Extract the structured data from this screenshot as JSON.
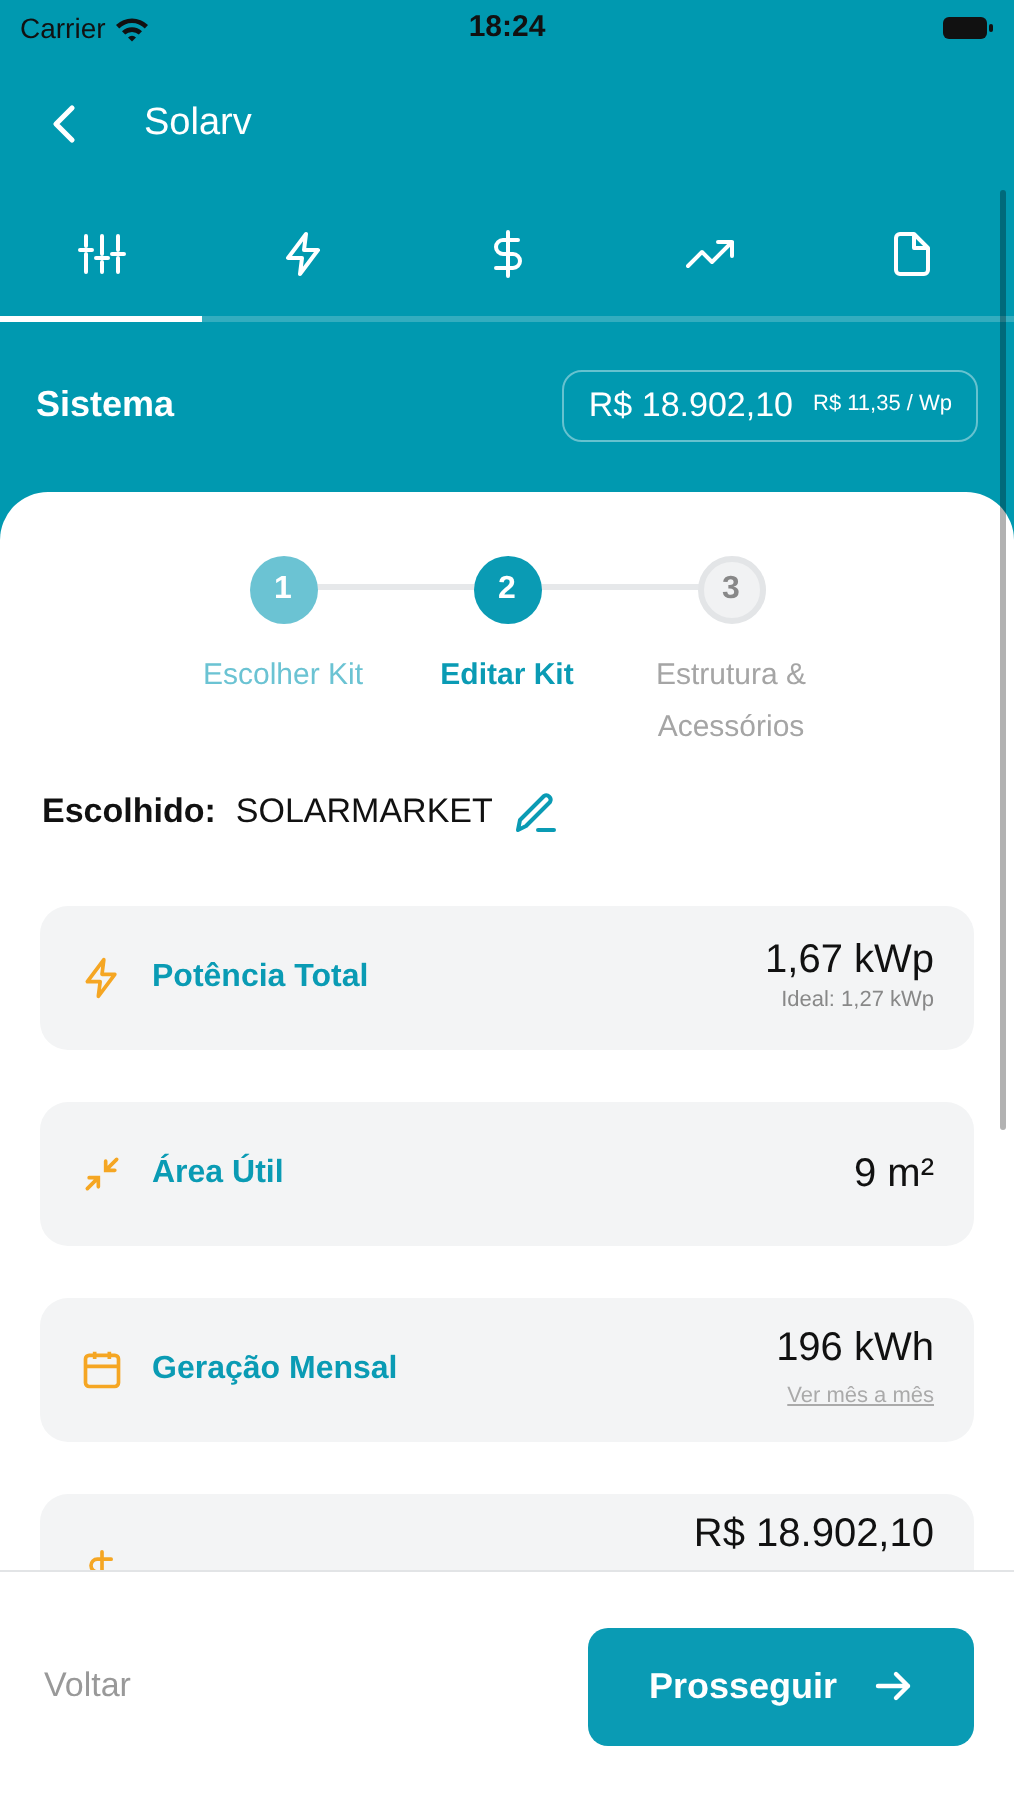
{
  "status_bar": {
    "carrier": "Carrier",
    "time": "18:24"
  },
  "header": {
    "title": "Solarv"
  },
  "tabs": [
    {
      "kind": "sliders",
      "selected": true
    },
    {
      "kind": "bolt",
      "selected": false
    },
    {
      "kind": "dollar",
      "selected": false
    },
    {
      "kind": "trend",
      "selected": false
    },
    {
      "kind": "file",
      "selected": false
    }
  ],
  "summary": {
    "label": "Sistema",
    "price": "R$ 18.902,10",
    "unit_price": "R$ 11,35 / Wp"
  },
  "steps": [
    {
      "number": "1",
      "label": "Escolher Kit",
      "completed": true,
      "selected": false
    },
    {
      "number": "2",
      "label": "Editar Kit",
      "completed": false,
      "selected": true
    },
    {
      "number": "3",
      "label": "Estrutura & Acessórios",
      "completed": false,
      "selected": false
    }
  ],
  "chosen": {
    "label": "Escolhido:",
    "value": "SOLARMARKET"
  },
  "cards": [
    {
      "kind": "bolt",
      "label": "Potência Total",
      "value": "1,67 kWp",
      "note": "Ideal: 1,27 kWp"
    },
    {
      "kind": "arrows",
      "label": "Área Útil",
      "value": "9 m²"
    },
    {
      "kind": "calendar",
      "label": "Geração Mensal",
      "value": "196 kWh",
      "link": "Ver mês a mês"
    },
    {
      "kind": "dollar",
      "value": "R$ 18.902,10"
    }
  ],
  "footer": {
    "back": "Voltar",
    "next": "Prosseguir"
  }
}
